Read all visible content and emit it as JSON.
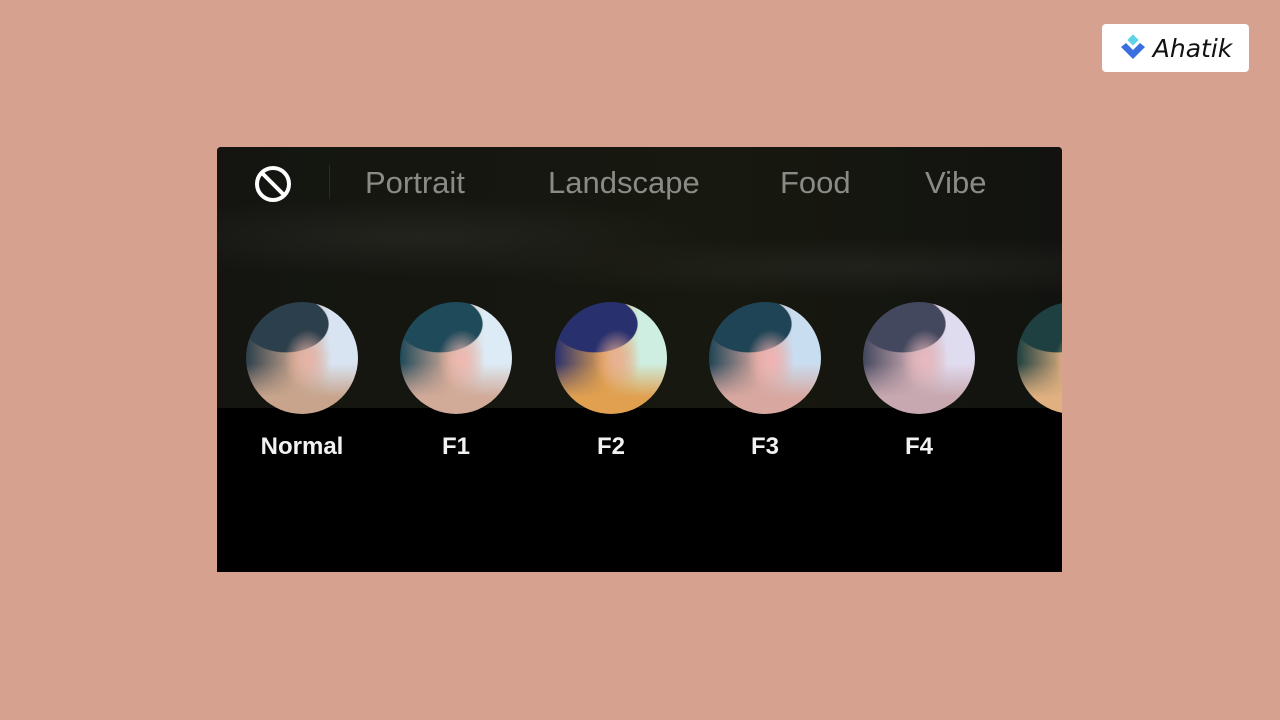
{
  "brand": {
    "logo_text": "Ahatik",
    "colors": {
      "diamond_top": "#5ed3e8",
      "chevron": "#3b6fe0"
    }
  },
  "filter_panel": {
    "none_icon": "prohibited-icon",
    "tabs": [
      {
        "label": "Portrait"
      },
      {
        "label": "Landscape"
      },
      {
        "label": "Food"
      },
      {
        "label": "Vibe"
      }
    ],
    "filters": [
      {
        "label": "Normal",
        "tint": {
          "hat": "#2c3f4c",
          "bg": "#d8e4f2",
          "skin": "#e8b3a6",
          "hair": "#c8a48c"
        }
      },
      {
        "label": "F1",
        "tint": {
          "hat": "#1f4a5a",
          "bg": "#dcebf5",
          "skin": "#f0b8b0",
          "hair": "#d2aa98"
        }
      },
      {
        "label": "F2",
        "tint": {
          "hat": "#28306e",
          "bg": "#cdeee0",
          "skin": "#eab095",
          "hair": "#e0a050"
        }
      },
      {
        "label": "F3",
        "tint": {
          "hat": "#1f4456",
          "bg": "#c9ddf0",
          "skin": "#f2b2b0",
          "hair": "#d8a8a0"
        }
      },
      {
        "label": "F4",
        "tint": {
          "hat": "#43485e",
          "bg": "#e0dcef",
          "skin": "#e8b8bc",
          "hair": "#c8a8b0"
        }
      },
      {
        "label": "",
        "tint": {
          "hat": "#1f4040",
          "bg": "#d8e0e8",
          "skin": "#f0b89a",
          "hair": "#e0b080"
        }
      }
    ]
  }
}
